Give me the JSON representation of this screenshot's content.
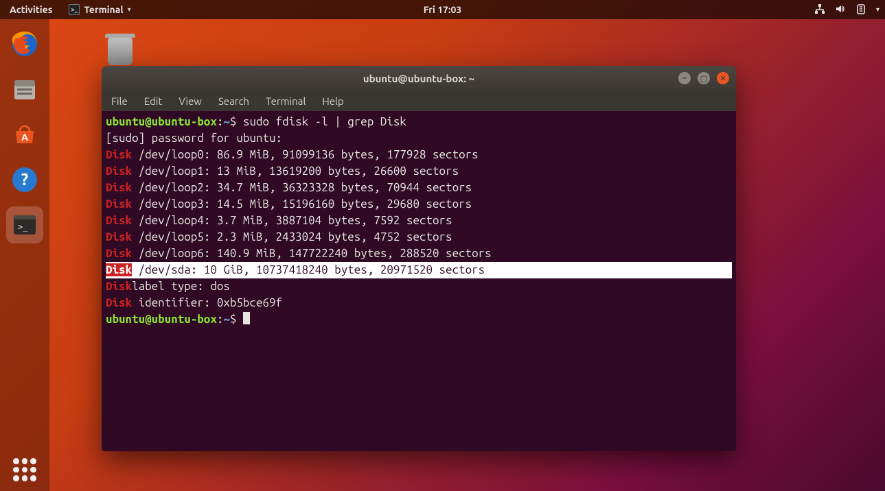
{
  "topbar": {
    "activities": "Activities",
    "app_label": "Terminal",
    "clock": "Fri 17:03"
  },
  "terminal": {
    "title": "ubuntu@ubuntu-box: ~",
    "menu": {
      "file": "File",
      "edit": "Edit",
      "view": "View",
      "search": "Search",
      "terminal": "Terminal",
      "help": "Help"
    },
    "prompt": {
      "user_host": "ubuntu@ubuntu-box",
      "colon": ":",
      "cwd": "~",
      "suffix": "$ "
    },
    "command": "sudo fdisk -l | grep Disk",
    "sudo_line": "[sudo] password for ubuntu:",
    "keyword": "Disk",
    "lines": [
      {
        "rest": " /dev/loop0: 86.9 MiB, 91099136 bytes, 177928 sectors"
      },
      {
        "rest": " /dev/loop1: 13 MiB, 13619200 bytes, 26600 sectors"
      },
      {
        "rest": " /dev/loop2: 34.7 MiB, 36323328 bytes, 70944 sectors"
      },
      {
        "rest": " /dev/loop3: 14.5 MiB, 15196160 bytes, 29680 sectors"
      },
      {
        "rest": " /dev/loop4: 3.7 MiB, 3887104 bytes, 7592 sectors"
      },
      {
        "rest": " /dev/loop5: 2.3 MiB, 2433024 bytes, 4752 sectors"
      },
      {
        "rest": " /dev/loop6: 140.9 MiB, 147722240 bytes, 288520 sectors"
      }
    ],
    "selected": {
      "rest": " /dev/sda: 10 GiB, 10737418240 bytes, 20971520 sectors"
    },
    "label_line_rest": "label type: dos",
    "ident_line_rest": " identifier: 0xb5bce69f"
  }
}
